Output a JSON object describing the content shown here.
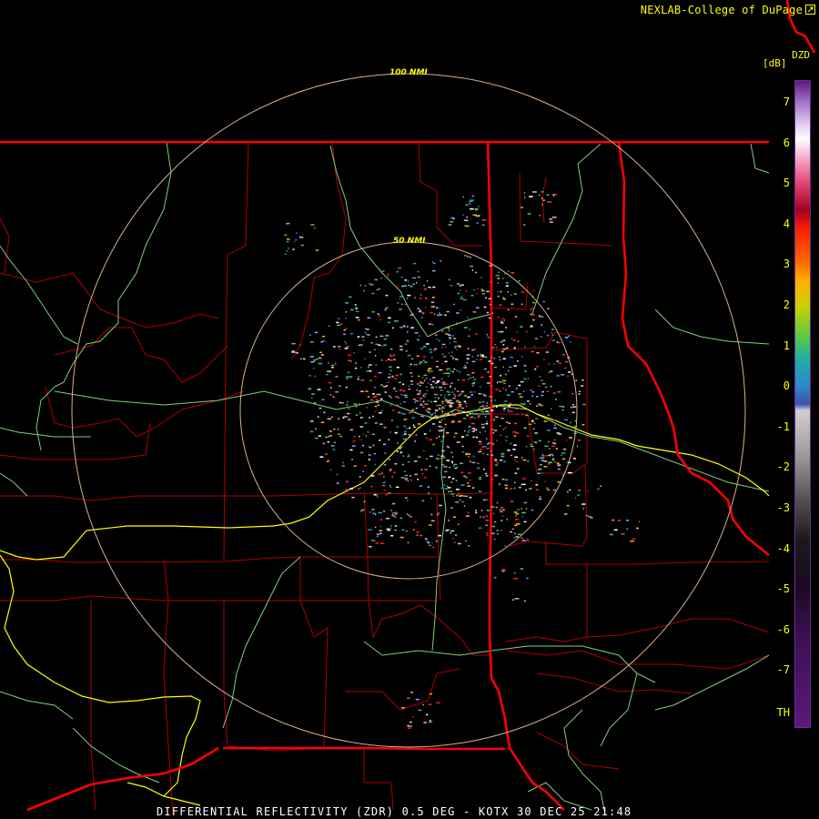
{
  "header": {
    "credit": "NEXLAB-College of DuPage"
  },
  "legend": {
    "product": "DZD",
    "units": "[dB]",
    "ticks": [
      "7",
      "6",
      "5",
      "4",
      "3",
      "2",
      "1",
      "0",
      "-1",
      "-2",
      "-3",
      "-4",
      "-5",
      "-6",
      "-7",
      "TH"
    ]
  },
  "rings": {
    "inner_label": "50 NMI",
    "outer_label": "100 NMI"
  },
  "footer": {
    "caption": "DIFFERENTIAL REFLECTIVITY (ZDR) 0.5 DEG - KOTX 30 DEC 25 21:48"
  },
  "colors": {
    "background": "#000000",
    "state_border": "#ff0000",
    "county_border": "#b00000",
    "rivers": "#7fcf7f",
    "highway": "#ffff00",
    "range_ring": "#d9b08c",
    "text": "#ffff00"
  }
}
